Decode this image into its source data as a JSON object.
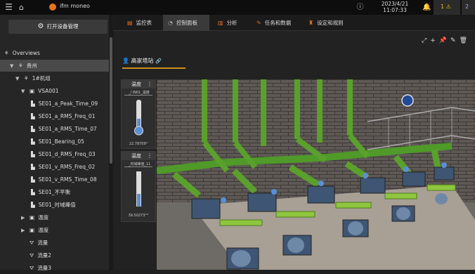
{
  "topbar": {
    "app_name": "ifm moneo",
    "date": "2023/4/21",
    "time": "11:07:33",
    "alert_count_1": "1",
    "alert_count_2": "2"
  },
  "sidebar": {
    "device_mgmt_button": "打开设备管理",
    "tree": [
      {
        "label": "Overviews",
        "icon": "overview-icon",
        "level": 0,
        "arrow": ""
      },
      {
        "label": "贵州",
        "icon": "site-icon",
        "level": 1,
        "arrow": "▼",
        "selected": true
      },
      {
        "label": "1#机组",
        "icon": "group-icon",
        "level": 2,
        "arrow": "▼"
      },
      {
        "label": "VSA001",
        "icon": "sensor-icon",
        "level": 3,
        "arrow": "▼"
      },
      {
        "label": "SE01_a_Peak_Time_09",
        "icon": "chart-icon",
        "level": 4,
        "arrow": ""
      },
      {
        "label": "SE01_a_RMS_Freq_01",
        "icon": "chart-icon",
        "level": 4,
        "arrow": ""
      },
      {
        "label": "SE01_a_RMS_Time_07",
        "icon": "chart-icon",
        "level": 4,
        "arrow": ""
      },
      {
        "label": "SE01_Bearing_05",
        "icon": "chart-icon",
        "level": 4,
        "arrow": ""
      },
      {
        "label": "SE01_d_RMS_Freq_03",
        "icon": "chart-icon",
        "level": 4,
        "arrow": ""
      },
      {
        "label": "SE01_v_RMS_Freq_02",
        "icon": "chart-icon",
        "level": 4,
        "arrow": ""
      },
      {
        "label": "SE01_v_RMS_Time_08",
        "icon": "chart-icon",
        "level": 4,
        "arrow": ""
      },
      {
        "label": "SE01_不平衡",
        "icon": "chart-icon",
        "level": 4,
        "arrow": ""
      },
      {
        "label": "SE01_时域峰值",
        "icon": "chart-icon",
        "level": 4,
        "arrow": ""
      },
      {
        "label": "温度",
        "icon": "sensor-icon",
        "level": 3,
        "arrow": "▶"
      },
      {
        "label": "温度",
        "icon": "sensor-icon",
        "level": 3,
        "arrow": "▶"
      },
      {
        "label": "流量",
        "icon": "flow-icon",
        "level": 3,
        "arrow": ""
      },
      {
        "label": "流量2",
        "icon": "flow-icon",
        "level": 3,
        "arrow": ""
      },
      {
        "label": "流量3",
        "icon": "flow-icon",
        "level": 3,
        "arrow": ""
      }
    ]
  },
  "tabs": [
    {
      "label": "监控表",
      "icon": "table-icon"
    },
    {
      "label": "控制面板",
      "icon": "dashboard-icon",
      "active": true
    },
    {
      "label": "分析",
      "icon": "analysis-icon"
    },
    {
      "label": "任务和数据",
      "icon": "tasks-icon"
    },
    {
      "label": "设定和规则",
      "icon": "rules-icon"
    }
  ],
  "dashboard": {
    "title": "高家塔站",
    "widgets": [
      {
        "title": "温度",
        "subtitle": "_/ IN01_温度",
        "value": "22.78709°",
        "level": 0.2
      },
      {
        "title": "温度",
        "subtitle": "_时域峰值_11",
        "value": "39.50273°°",
        "level": 0.35
      }
    ]
  },
  "colors": {
    "accent": "#e8711c",
    "pipe": "#5aa02c",
    "motor": "#3e5573"
  }
}
